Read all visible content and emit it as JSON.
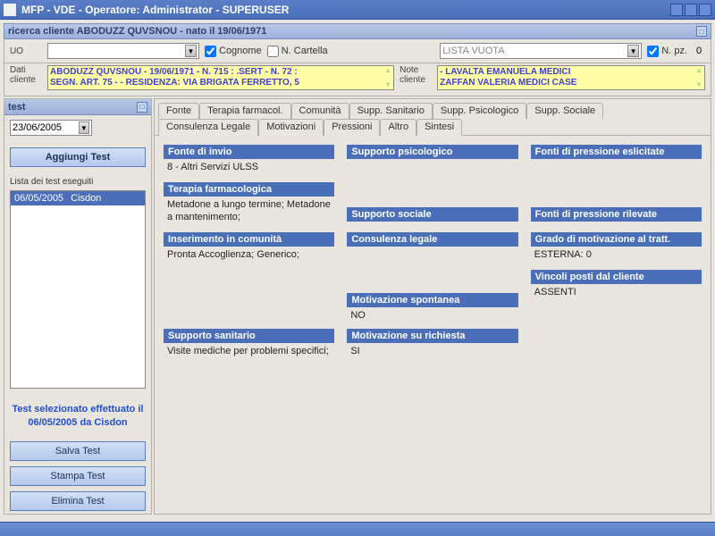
{
  "window": {
    "title": "MFP  -  VDE  - Operatore: Administrator  -  SUPERUSER"
  },
  "search": {
    "title": "ricerca cliente  ABODUZZ QUVSNOU  - nato il 19/06/1971",
    "uo_label": "UO",
    "cognome_label": "Cognome",
    "ncartella_label": "N. Cartella",
    "lista_text": "LISTA VUOTA",
    "npz_label": "N. pz.",
    "npz_value": "0",
    "dati_label": "Dati cliente",
    "dati_line1": "ABODUZZ QUVSNOU - 19/06/1971 - N. 715 : .SERT - N. 72 :",
    "dati_line2": "SEGN. ART. 75 -  - RESIDENZA: VIA BRIGATA FERRETTO, 5",
    "note_label": "Note cliente",
    "note_line1": "- LAVALTA EMANUELA MEDICI",
    "note_line2": "ZAFFAN VALERIA MEDICI CASE"
  },
  "sidebar": {
    "header": "test",
    "date": "23/06/2005",
    "add_btn": "Aggiungi Test",
    "list_label": "Lista dei test eseguiti",
    "tests": [
      {
        "date": "06/05/2005",
        "name": "Cisdon"
      }
    ],
    "sel_info": "Test selezionato effettuato il 06/05/2005 da Cisdon",
    "save_btn": "Salva Test",
    "print_btn": "Stampa Test",
    "delete_btn": "Elimina Test"
  },
  "tabs": {
    "row1": [
      "Fonte",
      "Terapia farmacol.",
      "Comunità",
      "Supp. Sanitario",
      "Supp. Psicologico",
      "Supp. Sociale"
    ],
    "row2": [
      "Consulenza Legale",
      "Motivazioni",
      "Pressioni",
      "Altro",
      "Sintesi"
    ],
    "active": "Sintesi"
  },
  "blocks": {
    "fonte": {
      "h": "Fonte di invio",
      "v": "8  - Altri Servizi ULSS"
    },
    "terapia": {
      "h": "Terapia farmacologica",
      "v": "Metadone a lungo termine; Metadone a mantenimento;"
    },
    "comunita": {
      "h": "Inserimento in comunità",
      "v": "Pronta Accoglienza; Generico;"
    },
    "sanitario": {
      "h": "Supporto sanitario",
      "v": "Visite mediche per problemi specifici;"
    },
    "psico": {
      "h": "Supporto psicologico",
      "v": ""
    },
    "sociale": {
      "h": "Supporto sociale",
      "v": ""
    },
    "legale": {
      "h": "Consulenza legale",
      "v": ""
    },
    "mot_spont": {
      "h": "Motivazione spontanea",
      "v": "NO"
    },
    "mot_rich": {
      "h": "Motivazione su richiesta",
      "v": "SI"
    },
    "press_esl": {
      "h": "Fonti di pressione eslicitate",
      "v": ""
    },
    "press_ril": {
      "h": "Fonti di pressione rilevate",
      "v": ""
    },
    "grado": {
      "h": "Grado di motivazione al tratt.",
      "v": "ESTERNA: 0"
    },
    "vincoli": {
      "h": "Vincoli posti dal cliente",
      "v": "ASSENTI"
    }
  }
}
